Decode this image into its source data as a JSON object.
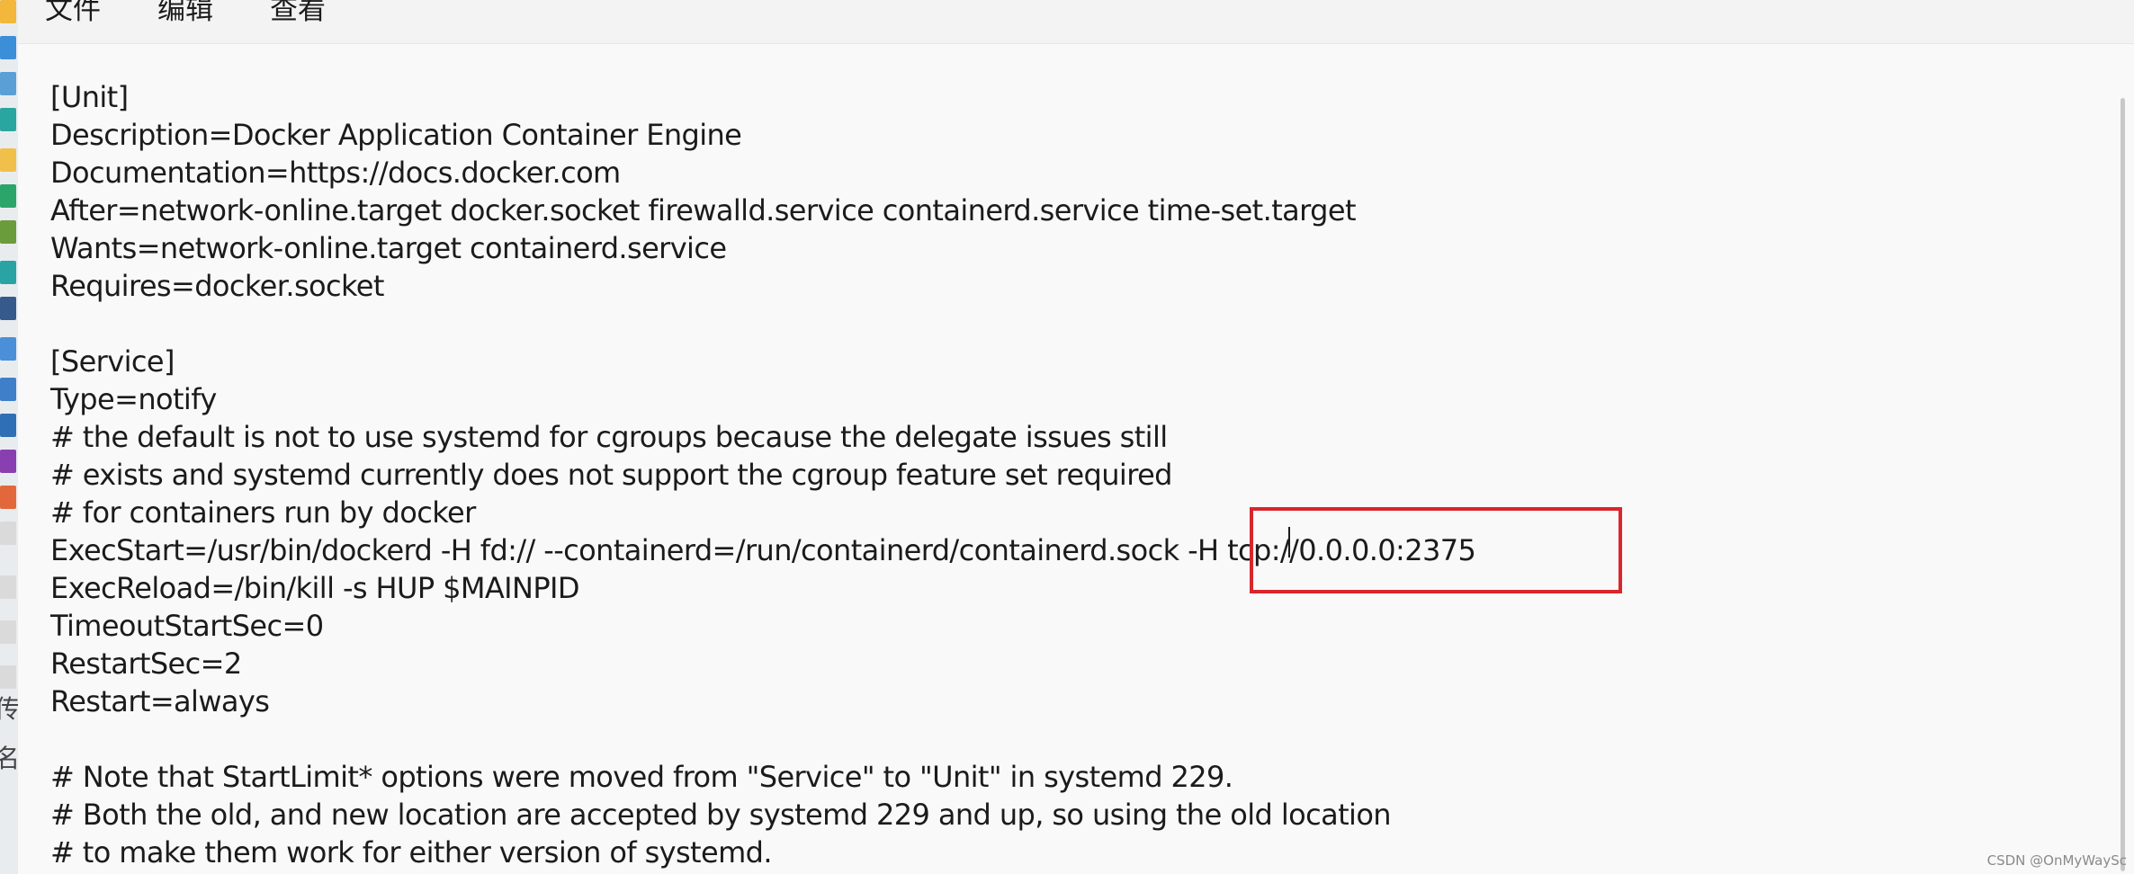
{
  "menu": {
    "file": "文件",
    "edit": "编辑",
    "view": "查看"
  },
  "left_strip": {
    "glyph_1": "传",
    "glyph_2": "名"
  },
  "editor": {
    "lines": [
      "[Unit]",
      "Description=Docker Application Container Engine",
      "Documentation=https://docs.docker.com",
      "After=network-online.target docker.socket firewalld.service containerd.service time-set.target",
      "Wants=network-online.target containerd.service",
      "Requires=docker.socket",
      "",
      "[Service]",
      "Type=notify",
      "# the default is not to use systemd for cgroups because the delegate issues still",
      "# exists and systemd currently does not support the cgroup feature set required",
      "# for containers run by docker",
      "ExecStart=/usr/bin/dockerd -H fd:// --containerd=/run/containerd/containerd.sock -H tcp://0.0.0.0:2375",
      "ExecReload=/bin/kill -s HUP $MAINPID",
      "TimeoutStartSec=0",
      "RestartSec=2",
      "Restart=always",
      "",
      "# Note that StartLimit* options were moved from \"Service\" to \"Unit\" in systemd 229.",
      "# Both the old, and new location are accepted by systemd 229 and up, so using the old location",
      "# to make them work for either version of systemd."
    ]
  },
  "annotation": {
    "box_color": "#d9262c"
  },
  "watermark": "CSDN @OnMyWaySc"
}
